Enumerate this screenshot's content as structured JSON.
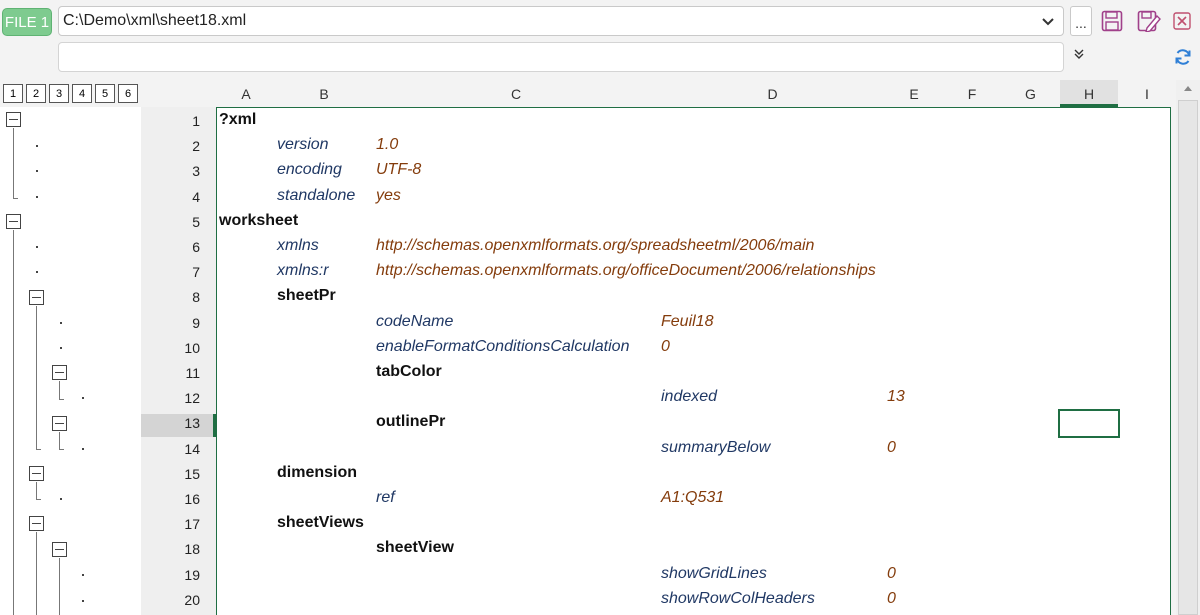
{
  "toolbar": {
    "file_badge": "FILE 1",
    "path": "C:\\Demo\\xml\\sheet18.xml",
    "browse_label": "...",
    "expand_glyph": "»",
    "chevron_glyph": "⌄"
  },
  "levels": [
    "1",
    "2",
    "3",
    "4",
    "5",
    "6"
  ],
  "columns": [
    "A",
    "B",
    "C",
    "D",
    "E",
    "F",
    "G",
    "H",
    "I"
  ],
  "active_column": "H",
  "active_row": "13",
  "rows": [
    {
      "num": "1",
      "cells": [
        {
          "col": "A",
          "text": "?xml",
          "kind": "el"
        }
      ]
    },
    {
      "num": "2",
      "cells": [
        {
          "col": "B",
          "text": "version",
          "kind": "attr"
        },
        {
          "col": "C",
          "text": "1.0",
          "kind": "val"
        }
      ]
    },
    {
      "num": "3",
      "cells": [
        {
          "col": "B",
          "text": "encoding",
          "kind": "attr"
        },
        {
          "col": "C",
          "text": "UTF-8",
          "kind": "val"
        }
      ]
    },
    {
      "num": "4",
      "cells": [
        {
          "col": "B",
          "text": "standalone",
          "kind": "attr"
        },
        {
          "col": "C",
          "text": "yes",
          "kind": "val"
        }
      ]
    },
    {
      "num": "5",
      "cells": [
        {
          "col": "A",
          "text": "worksheet",
          "kind": "el"
        }
      ]
    },
    {
      "num": "6",
      "cells": [
        {
          "col": "B",
          "text": "xmlns",
          "kind": "attr"
        },
        {
          "col": "C",
          "text": "http://schemas.openxmlformats.org/spreadsheetml/2006/main",
          "kind": "val"
        }
      ]
    },
    {
      "num": "7",
      "cells": [
        {
          "col": "B",
          "text": "xmlns:r",
          "kind": "attr"
        },
        {
          "col": "C",
          "text": "http://schemas.openxmlformats.org/officeDocument/2006/relationships",
          "kind": "val"
        }
      ]
    },
    {
      "num": "8",
      "cells": [
        {
          "col": "B",
          "text": "sheetPr",
          "kind": "el"
        }
      ]
    },
    {
      "num": "9",
      "cells": [
        {
          "col": "C",
          "text": "codeName",
          "kind": "attr"
        },
        {
          "col": "D",
          "text": "Feuil18",
          "kind": "val"
        }
      ]
    },
    {
      "num": "10",
      "cells": [
        {
          "col": "C",
          "text": "enableFormatConditionsCalculation",
          "kind": "attr"
        },
        {
          "col": "D",
          "text": "0",
          "kind": "val"
        }
      ]
    },
    {
      "num": "11",
      "cells": [
        {
          "col": "C",
          "text": "tabColor",
          "kind": "el"
        }
      ]
    },
    {
      "num": "12",
      "cells": [
        {
          "col": "D",
          "text": "indexed",
          "kind": "attr"
        },
        {
          "col": "E",
          "text": "13",
          "kind": "val"
        }
      ]
    },
    {
      "num": "13",
      "cells": [
        {
          "col": "C",
          "text": "outlinePr",
          "kind": "el"
        }
      ]
    },
    {
      "num": "14",
      "cells": [
        {
          "col": "D",
          "text": "summaryBelow",
          "kind": "attr"
        },
        {
          "col": "E",
          "text": "0",
          "kind": "val"
        }
      ]
    },
    {
      "num": "15",
      "cells": [
        {
          "col": "B",
          "text": "dimension",
          "kind": "el"
        }
      ]
    },
    {
      "num": "16",
      "cells": [
        {
          "col": "C",
          "text": "ref",
          "kind": "attr"
        },
        {
          "col": "D",
          "text": "A1:Q531",
          "kind": "val"
        }
      ]
    },
    {
      "num": "17",
      "cells": [
        {
          "col": "B",
          "text": "sheetViews",
          "kind": "el"
        }
      ]
    },
    {
      "num": "18",
      "cells": [
        {
          "col": "C",
          "text": "sheetView",
          "kind": "el"
        }
      ]
    },
    {
      "num": "19",
      "cells": [
        {
          "col": "D",
          "text": "showGridLines",
          "kind": "attr"
        },
        {
          "col": "E",
          "text": "0",
          "kind": "val"
        }
      ]
    },
    {
      "num": "20",
      "cells": [
        {
          "col": "D",
          "text": "showRowColHeaders",
          "kind": "attr"
        },
        {
          "col": "E",
          "text": "0",
          "kind": "val"
        }
      ]
    }
  ],
  "colors": {
    "element": "#111111",
    "attribute": "#203864",
    "value": "#843c0c",
    "accent_green": "#1f6e43",
    "file_badge": "#7ecb8f"
  },
  "icons": [
    "save-icon",
    "save-as-icon",
    "close-icon",
    "refresh-icon",
    "chevron-down-icon",
    "expand-icon"
  ]
}
